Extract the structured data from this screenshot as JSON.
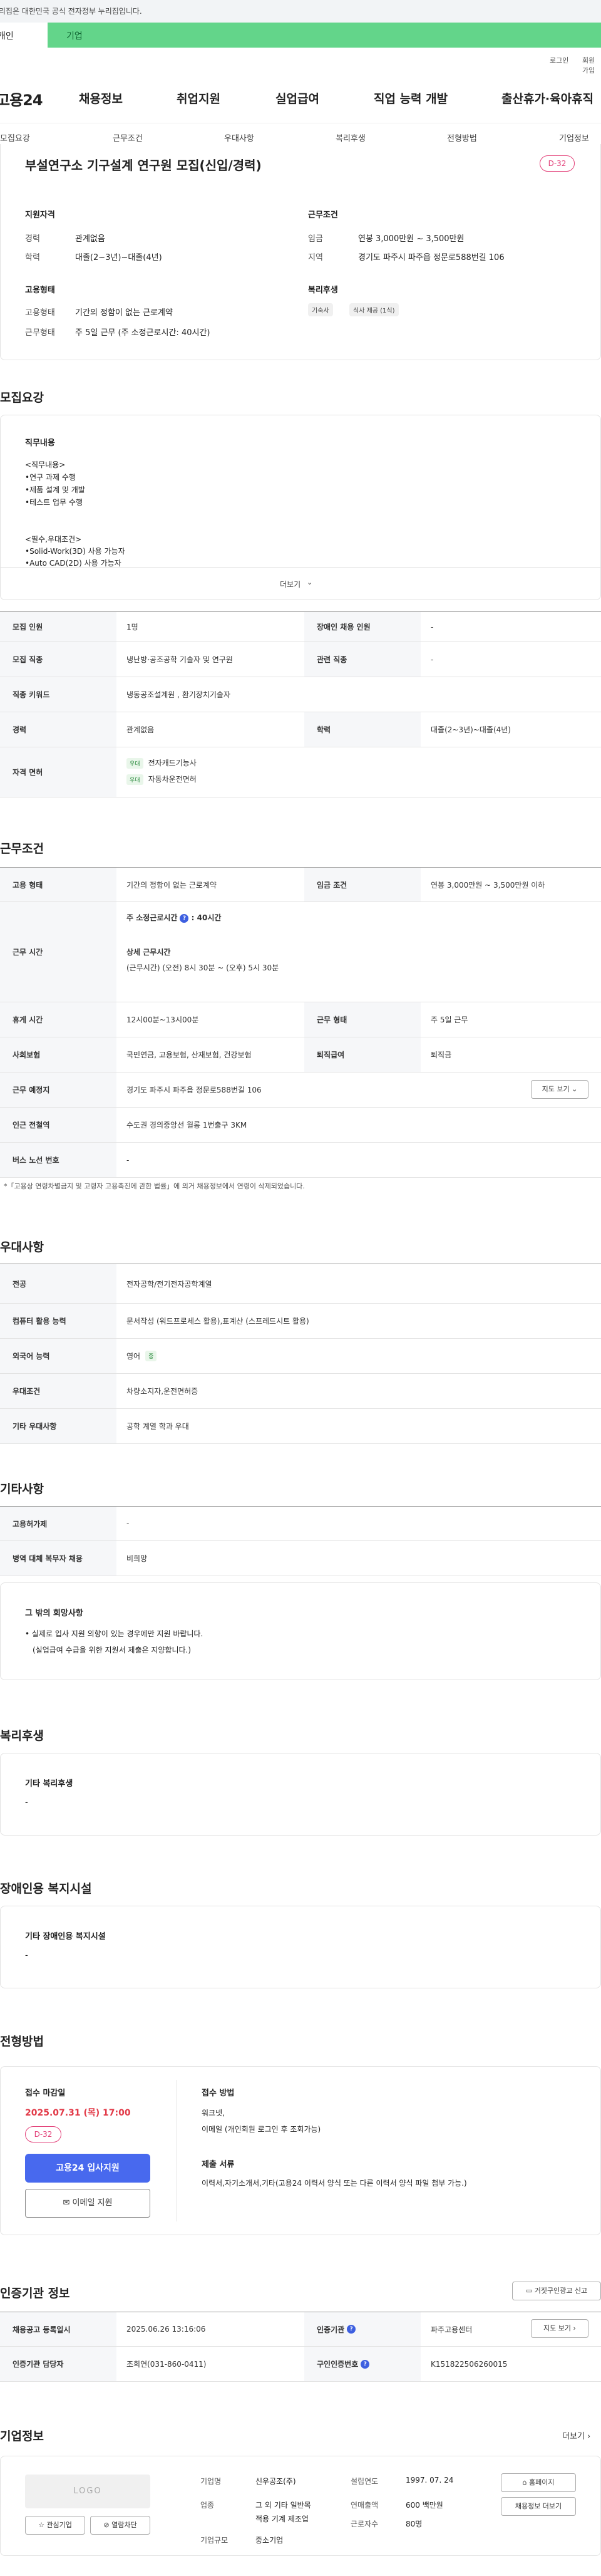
{
  "gov_notice": "이 누리집은 대한민국 공식 전자정부 누리집입니다.",
  "user_tabs": {
    "individual": "개인",
    "business": "기업"
  },
  "util": {
    "login": "로그인",
    "signup": "회원가입"
  },
  "site": {
    "logo": "고용24"
  },
  "gnb": [
    "채용정보",
    "취업지원",
    "실업급여",
    "직업 능력 개발",
    "출산휴가·육아휴직"
  ],
  "anchors": [
    "모집요강",
    "근무조건",
    "우대사항",
    "복리후생",
    "전형방법",
    "기업정보"
  ],
  "summary": {
    "title": "부설연구소 기구설계 연구원 모집(신입/경력)",
    "dday": "D-32",
    "qual_title": "지원자격",
    "career_label": "경력",
    "career": "관계없음",
    "edu_label": "학력",
    "edu": "대졸(2~3년)~대졸(4년)",
    "cond_title": "근무조건",
    "wage_label": "임금",
    "wage": "연봉 3,000만원 ~ 3,500만원",
    "region_label": "지역",
    "region": "경기도 파주시 파주읍 정문로588번길 106",
    "emp_title": "고용형태",
    "emptype_label": "고용형태",
    "emptype": "기간의 정함이 없는 근로계약",
    "worktype_label": "근무형태",
    "worktype": "주 5일 근무 (주 소정근로시간: 40시간)",
    "welfare_title": "복리후생",
    "welfare_chips": [
      "기숙사",
      "식사 제공 (1식)"
    ]
  },
  "recruit": {
    "title": "모집요강",
    "duty_title": "직무내용",
    "duty_lines": [
      "<직무내용>",
      "•연구 과제 수행",
      "•제품 설계 및 개발",
      "•테스트 업무 수행"
    ],
    "req_lines": [
      "<필수,우대조건>",
      "•Solid-Work(3D) 사용 가능자",
      "•Auto CAD(2D) 사용 가능자"
    ],
    "more": "더보기",
    "headcount_label": "모집 인원",
    "headcount": "1명",
    "disabled_label": "장애인 채용 인원",
    "disabled": "-",
    "job_label": "모집 직종",
    "job": "냉난방·공조공학 기술자 및 연구원",
    "related_label": "관련 직종",
    "related": "-",
    "keyword_label": "직종 키워드",
    "keyword": "냉동공조설계원 , 환기장치기술자",
    "career_label": "경력",
    "career": "관계없음",
    "edu_label": "학력",
    "edu": "대졸(2~3년)~대졸(4년)",
    "license_label": "자격 면허",
    "licenses": [
      {
        "tag": "우대",
        "name": "전자캐드기능사"
      },
      {
        "tag": "우대",
        "name": "자동차운전면허"
      }
    ]
  },
  "conditions": {
    "title": "근무조건",
    "emptype_label": "고용 형태",
    "emptype": "기간의 정함이 없는 근로계약",
    "wage_label": "임금 조건",
    "wage": "연봉 3,000만원 ~ 3,500만원 이하",
    "time_label": "근무 시간",
    "hours_label": "주 소정근로시간",
    "hours": "40시간",
    "detail_label": "상세 근무시간",
    "detail": "(근무시간) (오전) 8시 30분 ~ (오후) 5시 30분",
    "break_label": "휴게 시간",
    "break": "12시00분~13시00분",
    "form_label": "근무 형태",
    "form": "주 5일 근무",
    "insurance_label": "사회보험",
    "insurance": "국민연금, 고용보험, 산재보험, 건강보험",
    "retire_label": "퇴직급여",
    "retire": "퇴직금",
    "place_label": "근무 예정지",
    "place": "경기도 파주시 파주읍 정문로588번길 106",
    "map_btn": "지도 보기",
    "station_label": "인근 전철역",
    "station": "수도권 경의중앙선 월롱 1번출구 3KM",
    "bus_label": "버스 노선 번호",
    "bus": "-",
    "note": "*「고용상 연령차별금지 및 고령자 고용촉진에 관한 법률」에 의거 채용정보에서 연령이 삭제되었습니다."
  },
  "prefer": {
    "title": "우대사항",
    "major_label": "전공",
    "major": "전자공학/전기전자공학계열",
    "pc_label": "컴퓨터 활용 능력",
    "pc": "문서작성 (워드프로세스 활용),표계산 (스프레드시트 활용)",
    "lang_label": "외국어 능력",
    "lang": "영어",
    "lang_tag": "중",
    "cond_label": "우대조건",
    "cond": "차량소지자,운전면허증",
    "etc_label": "기타 우대사항",
    "etc": "공학 계열 학과 우대"
  },
  "other": {
    "title": "기타사항",
    "subsidy_label": "고용허가제",
    "subsidy": "-",
    "military_label": "병역 대체 복무자 채용",
    "military": "비희망",
    "wish_title": "그 밖의 희망사항",
    "wish_lines": [
      "• 실제로 입사 지원 의향이 있는 경우에만 지원 바랍니다.",
      "(실업급여 수급을 위한 지원서 제출은 지양합니다.)"
    ]
  },
  "welfare": {
    "title": "복리후생",
    "sub": "기타 복리후생",
    "val": "-"
  },
  "disability": {
    "title": "장애인용 복지시설",
    "sub": "기타 장애인용 복지시설",
    "val": "-"
  },
  "process": {
    "title": "전형방법",
    "deadline_title": "접수 마감일",
    "deadline": "2025.07.31 (목) 17:00",
    "dday": "D-32",
    "apply_btn": "고용24 입사지원",
    "email_btn": "이메일 지원",
    "method_title": "접수 방법",
    "method_lines": [
      "워크넷,",
      "이메일 (개인회원 로그인 후 조회가능)"
    ],
    "docs_title": "제출 서류",
    "docs": "이력서,자기소개서,기타(고용24 이력서 양식 또는 다른 이력서 양식 파일 첨부 가능.)"
  },
  "agency": {
    "title": "인증기관 정보",
    "report_btn": "거짓구인광고 신고",
    "reg_label": "채용공고 등록일시",
    "reg": "2025.06.26 13:16:06",
    "org_label": "인증기관",
    "org": "파주고용센터",
    "map_btn": "지도 보기",
    "mgr_label": "인증기관 담당자",
    "mgr": "조희연(031-860-0411)",
    "no_label": "구인인증번호",
    "no": "K151822506260015"
  },
  "company": {
    "title": "기업정보",
    "more": "더보기",
    "logo_text": "LOGO",
    "interest_btn": "관심기업",
    "block_btn": "열람차단",
    "name_label": "기업명",
    "name": "신우공조(주)",
    "industry_label": "업종",
    "industry_lines": [
      "그 외 기타 일반목",
      "적용 기계 제조업"
    ],
    "size_label": "기업규모",
    "size": "중소기업",
    "est_label": "설립연도",
    "est": "1997. 07. 24",
    "sales_label": "연매출액",
    "sales": "600 백만원",
    "staff_label": "근로자수",
    "staff": "80명",
    "home_btn": "홈페이지",
    "jobs_btn": "채용정보 더보기"
  }
}
